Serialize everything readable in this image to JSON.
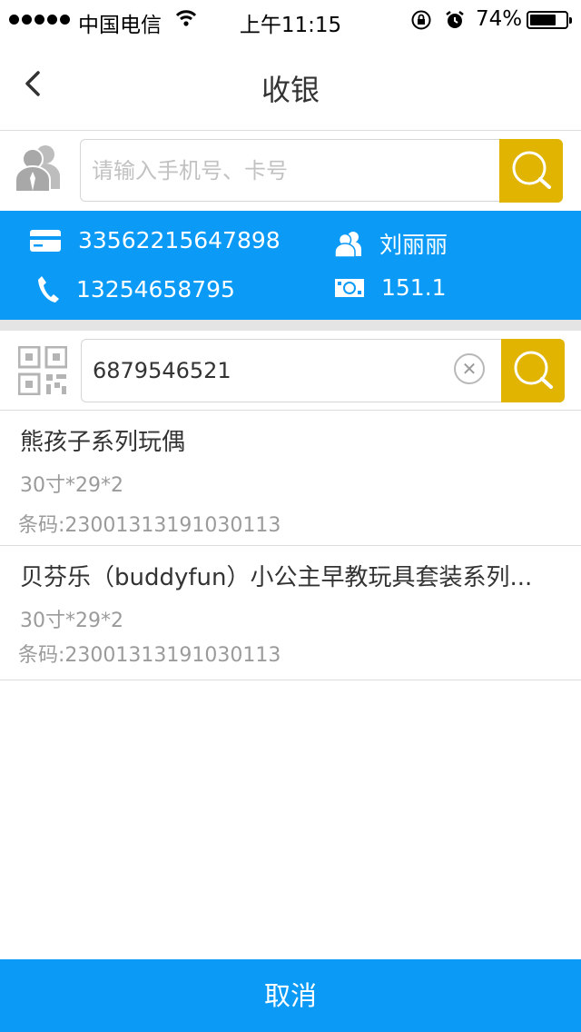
{
  "status_bar": {
    "carrier": "中国电信",
    "time": "上午11:15",
    "battery_percent": "74%",
    "battery_level": 0.74
  },
  "nav": {
    "title": "收银",
    "back_icon": "chevron-left-icon"
  },
  "member_search": {
    "placeholder": "请输入手机号、卡号",
    "icon": "members-icon",
    "button_icon": "search-icon"
  },
  "member_info": {
    "card_number": "33562215647898",
    "name": "刘丽丽",
    "phone": "13254658795",
    "balance": "151.1"
  },
  "product_search": {
    "value": "6879546521",
    "icon": "qr-code-icon",
    "clear_icon": "clear-icon",
    "button_icon": "search-icon"
  },
  "products": [
    {
      "name": "熊孩子系列玩偶",
      "spec": "30寸*29*2",
      "barcode": "条码:23001313191030113"
    },
    {
      "name": "贝芬乐（buddyfun）小公主早教玩具套装系列...",
      "spec": "30寸*29*2",
      "barcode": "条码:23001313191030113"
    }
  ],
  "footer": {
    "cancel_label": "取消"
  },
  "colors": {
    "accent_blue": "#0b9bf7",
    "search_yellow": "#e0b400"
  }
}
